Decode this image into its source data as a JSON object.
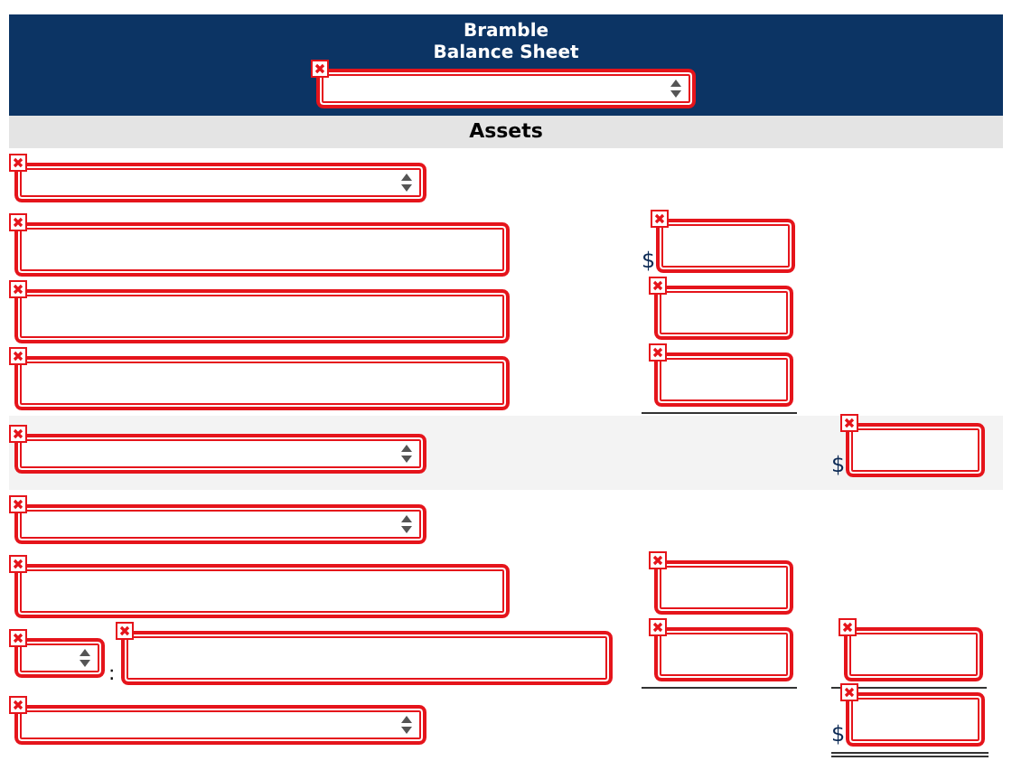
{
  "header": {
    "company": "Bramble",
    "statement": "Balance Sheet",
    "period": {
      "kind": "select",
      "error": true
    }
  },
  "section": "Assets",
  "rows": [
    {
      "shaded": false,
      "entries": [
        {
          "kind": "select",
          "error": true
        }
      ]
    },
    {
      "shaded": false,
      "entries": [
        {
          "kind": "text",
          "error": true
        }
      ],
      "amount": {
        "prefix": "$",
        "underline": false,
        "double": false,
        "error": true
      }
    },
    {
      "shaded": false,
      "entries": [
        {
          "kind": "text",
          "error": true
        }
      ],
      "amount": {
        "underline": false,
        "double": false,
        "error": true
      }
    },
    {
      "shaded": false,
      "entries": [
        {
          "kind": "text",
          "error": true
        }
      ],
      "amount": {
        "underline": true,
        "double": false,
        "error": true
      }
    },
    {
      "shaded": true,
      "entries": [
        {
          "kind": "select",
          "error": true
        }
      ],
      "total": {
        "prefix": "$",
        "underline": false,
        "double": false,
        "error": true
      }
    },
    {
      "shaded": false,
      "entries": [
        {
          "kind": "select",
          "error": true
        }
      ]
    },
    {
      "shaded": false,
      "entries": [
        {
          "kind": "text",
          "error": true
        }
      ],
      "amount": {
        "underline": false,
        "double": false,
        "error": true
      }
    },
    {
      "shaded": false,
      "entries": [
        {
          "kind": "short_select",
          "error": true,
          "after": ":"
        },
        {
          "kind": "short_text",
          "error": true
        }
      ],
      "amount": {
        "underline": true,
        "double": false,
        "error": true
      },
      "total": {
        "underline": true,
        "double": false,
        "error": true
      }
    },
    {
      "shaded": false,
      "entries": [
        {
          "kind": "select",
          "error": true
        }
      ],
      "total": {
        "prefix": "$",
        "underline": true,
        "double": true,
        "error": true
      }
    }
  ]
}
